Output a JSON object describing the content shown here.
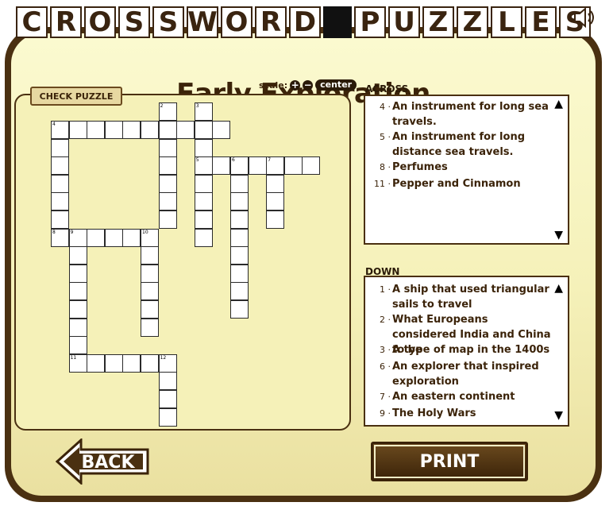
{
  "banner_left": [
    "C",
    "R",
    "O",
    "S",
    "S",
    "W",
    "O",
    "R",
    "D"
  ],
  "banner_right": [
    "P",
    "U",
    "Z",
    "Z",
    "L",
    "E",
    "S"
  ],
  "title": "Early Exploration",
  "scale": {
    "label": "scale:",
    "zoom_in": "+",
    "zoom_out": "−",
    "center": "center"
  },
  "check_label": "CHECK PUZZLE",
  "across_title": "ACROSS",
  "down_title": "DOWN",
  "across": [
    {
      "n": "4 ·",
      "text": "An instrument for long sea travels."
    },
    {
      "n": "5 ·",
      "text": " An instrument for long distance sea travels."
    },
    {
      "n": "8 ·",
      "text": "Perfumes"
    },
    {
      "n": "11 ·",
      "text": "Pepper and Cinnamon"
    }
  ],
  "down": [
    {
      "n": "1 ·",
      "text": "A ship that used triangular sails to travel"
    },
    {
      "n": "2 ·",
      "text": "What Europeans considered India and China to be"
    },
    {
      "n": "3 ·",
      "text": "A type of map in the 1400s"
    },
    {
      "n": "6 ·",
      "text": "An explorer that inspired exploration"
    },
    {
      "n": "7 ·",
      "text": "An eastern continent"
    },
    {
      "n": "9 ·",
      "text": "The Holy Wars"
    }
  ],
  "back_label": "BACK",
  "print_label": "PRINT",
  "grid_cells": [
    [
      0,
      0
    ],
    [
      1,
      0
    ],
    [
      2,
      0
    ],
    [
      3,
      0
    ],
    [
      4,
      0
    ],
    [
      5,
      0
    ],
    [
      6,
      0
    ],
    [
      7,
      0
    ],
    [
      8,
      0
    ],
    [
      9,
      0
    ],
    [
      6,
      -1
    ],
    [
      8,
      -1
    ],
    [
      0,
      1
    ],
    [
      6,
      1
    ],
    [
      8,
      1
    ],
    [
      0,
      2
    ],
    [
      6,
      2
    ],
    [
      8,
      2
    ],
    [
      9,
      2
    ],
    [
      10,
      2
    ],
    [
      11,
      2
    ],
    [
      12,
      2
    ],
    [
      13,
      2
    ],
    [
      14,
      2
    ],
    [
      0,
      3
    ],
    [
      6,
      3
    ],
    [
      8,
      3
    ],
    [
      10,
      3
    ],
    [
      12,
      3
    ],
    [
      0,
      4
    ],
    [
      6,
      4
    ],
    [
      8,
      4
    ],
    [
      10,
      4
    ],
    [
      12,
      4
    ],
    [
      0,
      5
    ],
    [
      6,
      5
    ],
    [
      8,
      5
    ],
    [
      10,
      5
    ],
    [
      12,
      5
    ],
    [
      0,
      6
    ],
    [
      1,
      6
    ],
    [
      2,
      6
    ],
    [
      3,
      6
    ],
    [
      4,
      6
    ],
    [
      5,
      6
    ],
    [
      8,
      6
    ],
    [
      10,
      6
    ],
    [
      1,
      7
    ],
    [
      5,
      7
    ],
    [
      10,
      7
    ],
    [
      1,
      8
    ],
    [
      5,
      8
    ],
    [
      10,
      8
    ],
    [
      1,
      9
    ],
    [
      5,
      9
    ],
    [
      10,
      9
    ],
    [
      1,
      10
    ],
    [
      5,
      10
    ],
    [
      10,
      10
    ],
    [
      1,
      11
    ],
    [
      5,
      11
    ],
    [
      1,
      12
    ],
    [
      1,
      13
    ],
    [
      2,
      13
    ],
    [
      3,
      13
    ],
    [
      4,
      13
    ],
    [
      5,
      13
    ],
    [
      6,
      13
    ],
    [
      6,
      14
    ],
    [
      6,
      15
    ],
    [
      6,
      16
    ]
  ],
  "grid_numbers": [
    {
      "c": 6,
      "r": -1,
      "n": "2"
    },
    {
      "c": 8,
      "r": -1,
      "n": "3"
    },
    {
      "c": 0,
      "r": 0,
      "n": "4"
    },
    {
      "c": 8,
      "r": 2,
      "n": "5"
    },
    {
      "c": 10,
      "r": 2,
      "n": "6"
    },
    {
      "c": 12,
      "r": 2,
      "n": "7"
    },
    {
      "c": 0,
      "r": 6,
      "n": "8"
    },
    {
      "c": 1,
      "r": 6,
      "n": "9"
    },
    {
      "c": 5,
      "r": 6,
      "n": "10"
    },
    {
      "c": 1,
      "r": 13,
      "n": "11"
    },
    {
      "c": 6,
      "r": 13,
      "n": "12"
    }
  ]
}
